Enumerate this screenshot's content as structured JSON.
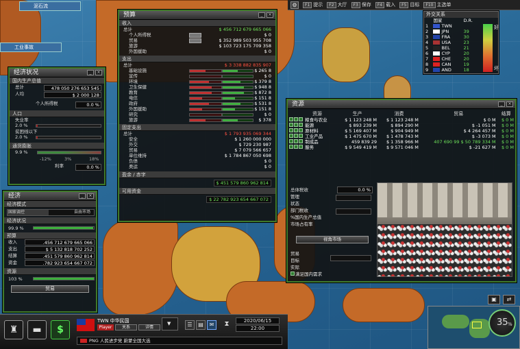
{
  "map_tags": {
    "tag1": "泥石流",
    "tag2": "工业事故"
  },
  "topbar": [
    {
      "key": "F1",
      "label": "提示"
    },
    {
      "key": "F2",
      "label": "大厅"
    },
    {
      "key": "F3",
      "label": "保存"
    },
    {
      "key": "F4",
      "label": "载入"
    },
    {
      "key": "F5",
      "label": "目标"
    },
    {
      "key": "F10",
      "label": "主选单"
    }
  ],
  "diplomacy": {
    "title": "外交关系",
    "col_country": "国家",
    "col_dr": "D.R.",
    "good": "好",
    "bad": "坏",
    "rows": [
      {
        "rank": "1",
        "code": "TWN",
        "dr": "",
        "flag": "#3355cc"
      },
      {
        "rank": "2",
        "code": "JPN",
        "dr": "39",
        "flag": "#ffffff"
      },
      {
        "rank": "3",
        "code": "FRA",
        "dr": "30",
        "flag": "#2244aa"
      },
      {
        "rank": "4",
        "code": "USA",
        "dr": "23",
        "flag": "#aa3333"
      },
      {
        "rank": "5",
        "code": "BEL",
        "dr": "21",
        "flag": "#222222"
      },
      {
        "rank": "6",
        "code": "CYP",
        "dr": "20",
        "flag": "#ffffff"
      },
      {
        "rank": "7",
        "code": "CHE",
        "dr": "20",
        "flag": "#dd2222"
      },
      {
        "rank": "8",
        "code": "CAN",
        "dr": "19",
        "flag": "#dd2222"
      },
      {
        "rank": "9",
        "code": "AND",
        "dr": "18",
        "flag": "#2244aa"
      }
    ]
  },
  "budget": {
    "title": "预算",
    "income_title": "收入",
    "income": [
      {
        "label": "总计",
        "value": "$ 456 712 679 665 066",
        "green": true,
        "btn": false
      },
      {
        "label": "个人所得税",
        "value": "$ 0",
        "green": false,
        "btn": true
      },
      {
        "label": "贸易",
        "value": "$ 352 989 503 955 708",
        "green": false,
        "btn": true
      },
      {
        "label": "旅游",
        "value": "$ 103 723 175 709 358",
        "green": false,
        "btn": false
      },
      {
        "label": "外国援助",
        "value": "$ 0",
        "green": false,
        "btn": false
      }
    ],
    "expense_title": "支出",
    "expense": [
      {
        "label": "总计",
        "value": "$ 3 338 882 835 907",
        "level": 0
      },
      {
        "label": "基础设施",
        "value": "$ 265 8",
        "level": 0.5
      },
      {
        "label": "宣传",
        "value": "$ 0",
        "level": 0
      },
      {
        "label": "环境",
        "value": "$ 379 8",
        "level": 0.6
      },
      {
        "label": "卫生保健",
        "value": "$ 948 8",
        "level": 0.7
      },
      {
        "label": "教育",
        "value": "$ 872 8",
        "level": 0.7
      },
      {
        "label": "电信",
        "value": "$ 151 8",
        "level": 0.4
      },
      {
        "label": "政府",
        "value": "$ 531 8",
        "level": 0.6
      },
      {
        "label": "外国援助",
        "value": "$ 151 8",
        "level": 0.4
      },
      {
        "label": "研究",
        "value": "$ 0",
        "level": 0
      },
      {
        "label": "旅游",
        "value": "$ 378",
        "level": 0.5
      }
    ],
    "fixed_title": "固定支出",
    "fixed": [
      {
        "label": "总计",
        "value": "$ 1 793 935 069 344",
        "red": true
      },
      {
        "label": "安全",
        "value": "$ 1 260 000 000",
        "red": false
      },
      {
        "label": "外交",
        "value": "$ 729 230 987",
        "red": false
      },
      {
        "label": "贸易",
        "value": "$ 7 079 566 657",
        "red": false
      },
      {
        "label": "单位维持",
        "value": "$ 1 784 867 050 698",
        "red": false
      },
      {
        "label": "负债",
        "value": "$ 0",
        "red": false
      },
      {
        "label": "奥运",
        "value": "$ 0",
        "red": false
      }
    ],
    "surplus_title": "盈余 / 赤字",
    "surplus_value": "$ 451 579 860 962 814",
    "available_title": "可用资金",
    "available_value": "$ 22 782 923 654 667 072"
  },
  "econ_status": {
    "title": "经济状况",
    "gdp_title": "国内生产总值",
    "total_label": "总计",
    "total_value": "478 050 276 653 545",
    "per_capita_label": "人均",
    "per_capita_value": "$ 2 000 128",
    "income_tax_label": "个人所得税",
    "income_tax_value": "0.0 %",
    "pop_title": "人口",
    "unemp_label": "失业率",
    "unemp_value": "2.0 %",
    "poverty_label": "贫困线以下",
    "poverty_value": "2.0 %",
    "inflation_title": "通货膨胀",
    "inflation_value": "9.9 %",
    "scale_min": "-12%",
    "scale_mid": "3%",
    "scale_max": "18%",
    "interest_label": "利率",
    "interest_value": "0.0 %"
  },
  "economy": {
    "title": "经济",
    "model_title": "经济模式",
    "model_left": "国家调控",
    "model_right": "自由市场",
    "model_level": 0.48,
    "health_title": "经济状况",
    "health_value": "99.9 %",
    "health_level": 0.99,
    "budget_title": "预算",
    "income_label": "收入",
    "income_value": ".456 712 679 665 066",
    "expense_label": "支出",
    "expense_value": "$ 5 132 818 702 252",
    "balance_label": "结算",
    "balance_value": ".451 579 860 962 814",
    "funds_label": "资金",
    "funds_value": ".782 923 654 667 072",
    "resources_title": "资源",
    "resources_value": "103 %",
    "trade_button": "贸易"
  },
  "resources": {
    "title": "资源",
    "cols": [
      "资源",
      "生产",
      "消费",
      "贸易",
      "结算"
    ],
    "rows": [
      {
        "name": "粮食与农业",
        "prod": "$ 1 123 248 M",
        "cons": "$ 1 123 248 M",
        "trade": "$ 0 M",
        "bal": "$ 0 M"
      },
      {
        "name": "能源",
        "prod": "$ 893 239 M",
        "cons": "$ 894 290 M",
        "trade": "$ -1 051 M",
        "bal": "$ 0 M"
      },
      {
        "name": "原材料",
        "prod": "$ 5 169 407 M",
        "cons": "$ 904 949 M",
        "trade": "$ 4 264 457 M",
        "bal": "$ 0 M"
      },
      {
        "name": "工业产品",
        "prod": "$ 1 475 670 M",
        "cons": "$ 1 478 743 M",
        "trade": "$ -3 073 M",
        "bal": "$ 0 M"
      },
      {
        "name": "制成品",
        "prod": "459 839 29",
        "cons": "$ 1 358 966 M",
        "trade": "407 690 99  $ 50 789 334 M",
        "bal": "$ 0 M"
      },
      {
        "name": "服务",
        "prod": "$ 9 549 419 M",
        "cons": "$ 9 571 046 M",
        "trade": "$ -21 627 M",
        "bal": "$ 0 M"
      }
    ],
    "tax_label": "总体税收",
    "tax_value": "0.0 %",
    "mgmt_label": "管理",
    "state_label": "状态",
    "sector_tax_label": "部门税收",
    "gdp_pct_label": "%国内生产总值",
    "market_share_label": "市场占有率",
    "view_market_button": "视角市场",
    "trade_label": "贸易",
    "target_label": "目标",
    "actual_label": "实际",
    "domestic_label": "满足国内需求"
  },
  "bottom": {
    "country_name": "TWN 中华民国",
    "player_label": "Player",
    "relations_button": "关系",
    "details_button": "详情",
    "news": "PNG 人民进步党 蔚蒙全国大选",
    "date": "2020/06/15",
    "time": "22:00",
    "minimap_percent": "35"
  }
}
